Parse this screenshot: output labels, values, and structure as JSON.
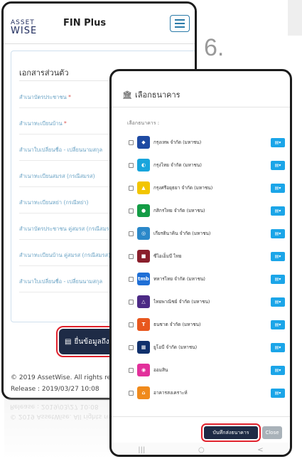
{
  "step_number": "6.",
  "phone1": {
    "logo_top": "ASSET",
    "logo_bottom": "WISE",
    "brand": "FIN Plus",
    "section_title": "เอกสารส่วนตัว",
    "documents": [
      {
        "label": "สำเนาบัตรประชาชน",
        "required": "*"
      },
      {
        "label": "สำเนาทะเบียนบ้าน",
        "required": "*"
      },
      {
        "label": "สำเนาใบเปลี่ยนชื่อ - เปลี่ยนนามสกุล",
        "required": ""
      },
      {
        "label": "สำเนาทะเบียนสมรส (กรณีสมรส)",
        "required": ""
      },
      {
        "label": "สำเนาทะเบียนหย่า (กรณีหย่า)",
        "required": ""
      },
      {
        "label": "สำเนาบัตรประชาชน คู่สมรส (กรณีสมรส)",
        "required": ""
      },
      {
        "label": "สำเนาทะเบียนบ้าน คู่สมรส (กรณีสมรส)",
        "required": ""
      },
      {
        "label": "สำเนาใบเปลี่ยนชื่อ - เปลี่ยนนามสกุล",
        "required": ""
      }
    ],
    "submit_label": "ยื่นข้อมูลถึง",
    "footer_copyright": "© 2019 AssetWise. All rights res",
    "footer_release": "Release : 2019/03/27 10:08"
  },
  "phone2": {
    "title": "เลือกธนาคาร",
    "subtitle": "เลือกธนาคาร :",
    "banks": [
      {
        "name": "กรุงเทพ จำกัด (มหาชน)",
        "color": "#1e4aa3",
        "glyph": "◆"
      },
      {
        "name": "กรุงไทย จำกัด (มหาชน)",
        "color": "#19a5dc",
        "glyph": "◐"
      },
      {
        "name": "กรุงศรีอยุธยา จำกัด (มหาชน)",
        "color": "#f2c500",
        "glyph": "▲"
      },
      {
        "name": "กสิกรไทย จำกัด (มหาชน)",
        "color": "#139c45",
        "glyph": "●"
      },
      {
        "name": "เกียรตินาคิน จำกัด (มหาชน)",
        "color": "#2b88c9",
        "glyph": "◎"
      },
      {
        "name": "ซีไอเอ็มบี ไทย",
        "color": "#8a1f2c",
        "glyph": "■"
      },
      {
        "name": "ทหารไทย จำกัด (มหาชน)",
        "color": "#1f6fd6",
        "glyph": "tmb"
      },
      {
        "name": "ไทยพาณิชย์ จำกัด (มหาชน)",
        "color": "#4c2a85",
        "glyph": "△"
      },
      {
        "name": "ธนชาต จำกัด (มหาชน)",
        "color": "#e8571e",
        "glyph": "T"
      },
      {
        "name": "ยูโอบี จำกัด (มหาชน)",
        "color": "#10306c",
        "glyph": "▦"
      },
      {
        "name": "ออมสิน",
        "color": "#e2309b",
        "glyph": "◉"
      },
      {
        "name": "อาคารสงเคราะห์",
        "color": "#f08a1c",
        "glyph": "⌂"
      }
    ],
    "bank_action": "▤▾",
    "save_label": "บันทึกส่งธนาคาร",
    "close_label": "Close",
    "nav": [
      "|||",
      "○",
      "<"
    ]
  }
}
